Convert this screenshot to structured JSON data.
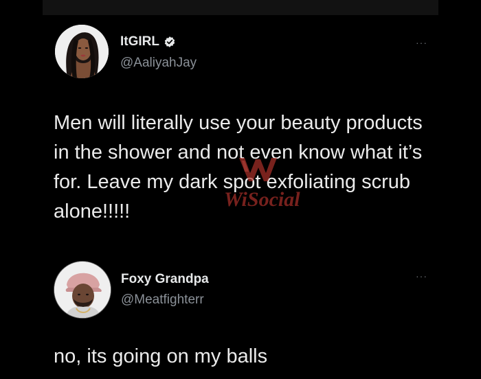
{
  "tweets": [
    {
      "display_name": "ItGIRL",
      "handle": "@AaliyahJay",
      "verified": true,
      "more_label": "···",
      "text": "Men will literally use your beauty products in the shower and not even know what it’s for. Leave my dark spot exfoliating scrub alone!!!!!"
    },
    {
      "display_name": "Foxy Grandpa",
      "handle": "@Meatfighterr",
      "verified": false,
      "more_label": "···",
      "text": "no, its going on my balls"
    }
  ],
  "watermark": {
    "text": "WiSocial",
    "color": "#b3332c"
  },
  "colors": {
    "background": "#000000",
    "text_primary": "#e7e9ea",
    "text_secondary": "#8b9198",
    "verified_badge": "#e7e9ea"
  },
  "icons": {
    "verified": "verified-badge-icon",
    "more": "more-options-icon"
  }
}
